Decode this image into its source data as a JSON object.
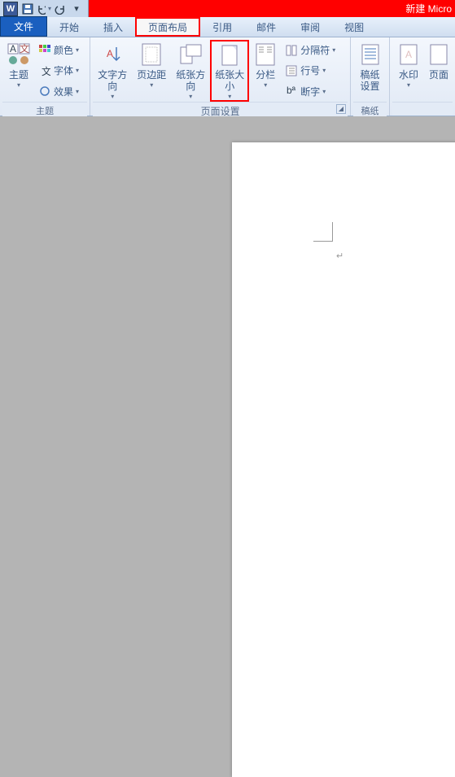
{
  "title_doc": "新建 Micro",
  "qat": {
    "word": "W"
  },
  "tabs": {
    "file": "文件",
    "home": "开始",
    "insert": "插入",
    "layout": "页面布局",
    "references": "引用",
    "mail": "邮件",
    "review": "审阅",
    "view": "视图"
  },
  "ribbon": {
    "theme": {
      "label": "主题",
      "btn": "主题",
      "colors": "颜色",
      "fonts": "字体",
      "effects": "效果"
    },
    "page_setup": {
      "label": "页面设置",
      "text_dir": "文字方向",
      "margins": "页边距",
      "orientation": "纸张方向",
      "size": "纸张大小",
      "columns": "分栏",
      "breaks": "分隔符",
      "line_num": "行号",
      "hyphen": "断字"
    },
    "manuscript": {
      "label": "稿纸",
      "btn1": "稿纸",
      "btn2": "设置"
    },
    "bg": {
      "watermark": "水印",
      "page": "页面"
    }
  }
}
